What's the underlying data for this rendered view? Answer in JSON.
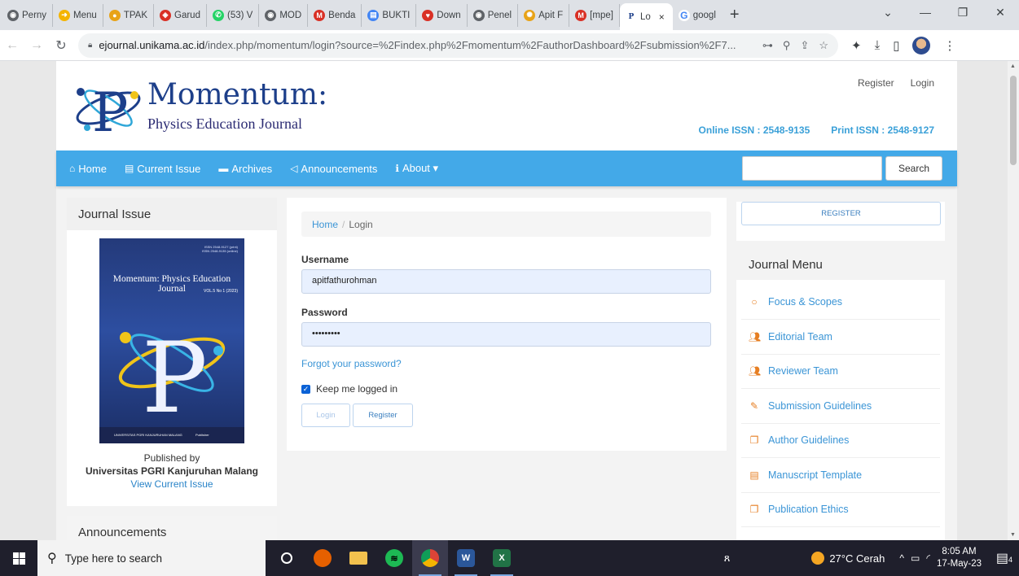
{
  "browser": {
    "tabs": [
      {
        "label": "Perny",
        "icon": "globe-icon",
        "color": "#5f6368"
      },
      {
        "label": "Menu",
        "icon": "arrow-icon",
        "color": "#f4b400"
      },
      {
        "label": "TPAK",
        "icon": "circle-icon",
        "color": "#e8a317"
      },
      {
        "label": "Garud",
        "icon": "garuda-icon",
        "color": "#d93025"
      },
      {
        "label": "(53) V",
        "icon": "whatsapp-icon",
        "color": "#25d366"
      },
      {
        "label": "MOD",
        "icon": "globe-icon",
        "color": "#5f6368"
      },
      {
        "label": "Benda",
        "icon": "gmail-icon",
        "color": "#d93025"
      },
      {
        "label": "BUKTI",
        "icon": "document-icon",
        "color": "#4285f4"
      },
      {
        "label": "Down",
        "icon": "heart-icon",
        "color": "#d93025"
      },
      {
        "label": "Penel",
        "icon": "globe-icon",
        "color": "#5f6368"
      },
      {
        "label": "Apit F",
        "icon": "seal-icon",
        "color": "#e8a317"
      },
      {
        "label": "[mpe]",
        "icon": "gmail-icon",
        "color": "#d93025"
      }
    ],
    "active_tab": {
      "label": "Lo",
      "close": "×"
    },
    "google_tab": {
      "label": "googl"
    },
    "new_tab": "+",
    "window_controls": {
      "chevron": "⌄",
      "minimize": "—",
      "restore": "❐",
      "close": "✕"
    },
    "url_host": "ejournal.unikama.ac.id",
    "url_path": "/index.php/momentum/login?source=%2Findex.php%2Fmomentum%2FauthorDashboard%2Fsubmission%2F7..."
  },
  "site": {
    "brand_title": "Momentum:",
    "brand_subtitle": "Physics Education Journal",
    "header_links": {
      "register": "Register",
      "login": "Login"
    },
    "issn_online": "Online ISSN : 2548-9135",
    "issn_print": "Print ISSN : 2548-9127",
    "nav": [
      {
        "label": "Home",
        "icon": "home-icon"
      },
      {
        "label": "Current Issue",
        "icon": "document-icon"
      },
      {
        "label": "Archives",
        "icon": "folder-icon"
      },
      {
        "label": "Announcements",
        "icon": "megaphone-icon"
      },
      {
        "label": "About ▾",
        "icon": "info-icon"
      }
    ],
    "search_button": "Search"
  },
  "left_sidebar": {
    "journal_issue_title": "Journal Issue",
    "cover_title": "Momentum: Physics Education Journal",
    "cover_volume": "VOL.5 No 1 (2023)",
    "cover_issn": "ISSN 2548-9127 (print)\nISSN 2548-9135 (online)",
    "cover_footer_left": "UNIVERSITAS PGRI KANJURUHAN MALANG",
    "cover_footer_right": "Publisher",
    "published_by": "Published by",
    "publisher": "Universitas PGRI Kanjuruhan Malang",
    "view_current": "View Current Issue",
    "announcements_title": "Announcements"
  },
  "login": {
    "breadcrumb_home": "Home",
    "breadcrumb_sep": "/",
    "breadcrumb_current": "Login",
    "username_label": "Username",
    "username_value": "apitfathurohman",
    "password_label": "Password",
    "password_value": "•••••••••",
    "forgot": "Forgot your password?",
    "keep_logged": "Keep me logged in",
    "login_button": "Login",
    "register_button": "Register"
  },
  "right_sidebar": {
    "register_button": "REGISTER",
    "menu_title": "Journal Menu",
    "menu_items": [
      {
        "label": "Focus & Scopes",
        "icon": "circle-icon"
      },
      {
        "label": "Editorial Team",
        "icon": "users-icon"
      },
      {
        "label": "Reviewer Team",
        "icon": "users-icon"
      },
      {
        "label": "Submission Guidelines",
        "icon": "edit-icon"
      },
      {
        "label": "Author Guidelines",
        "icon": "copy-icon"
      },
      {
        "label": "Manuscript Template",
        "icon": "file-icon"
      },
      {
        "label": "Publication Ethics",
        "icon": "copy-icon"
      }
    ]
  },
  "taskbar": {
    "search_placeholder": "Type here to search",
    "weather": "27°C Cerah",
    "time": "8:05 AM",
    "date": "17-May-23",
    "notifications": "4"
  }
}
